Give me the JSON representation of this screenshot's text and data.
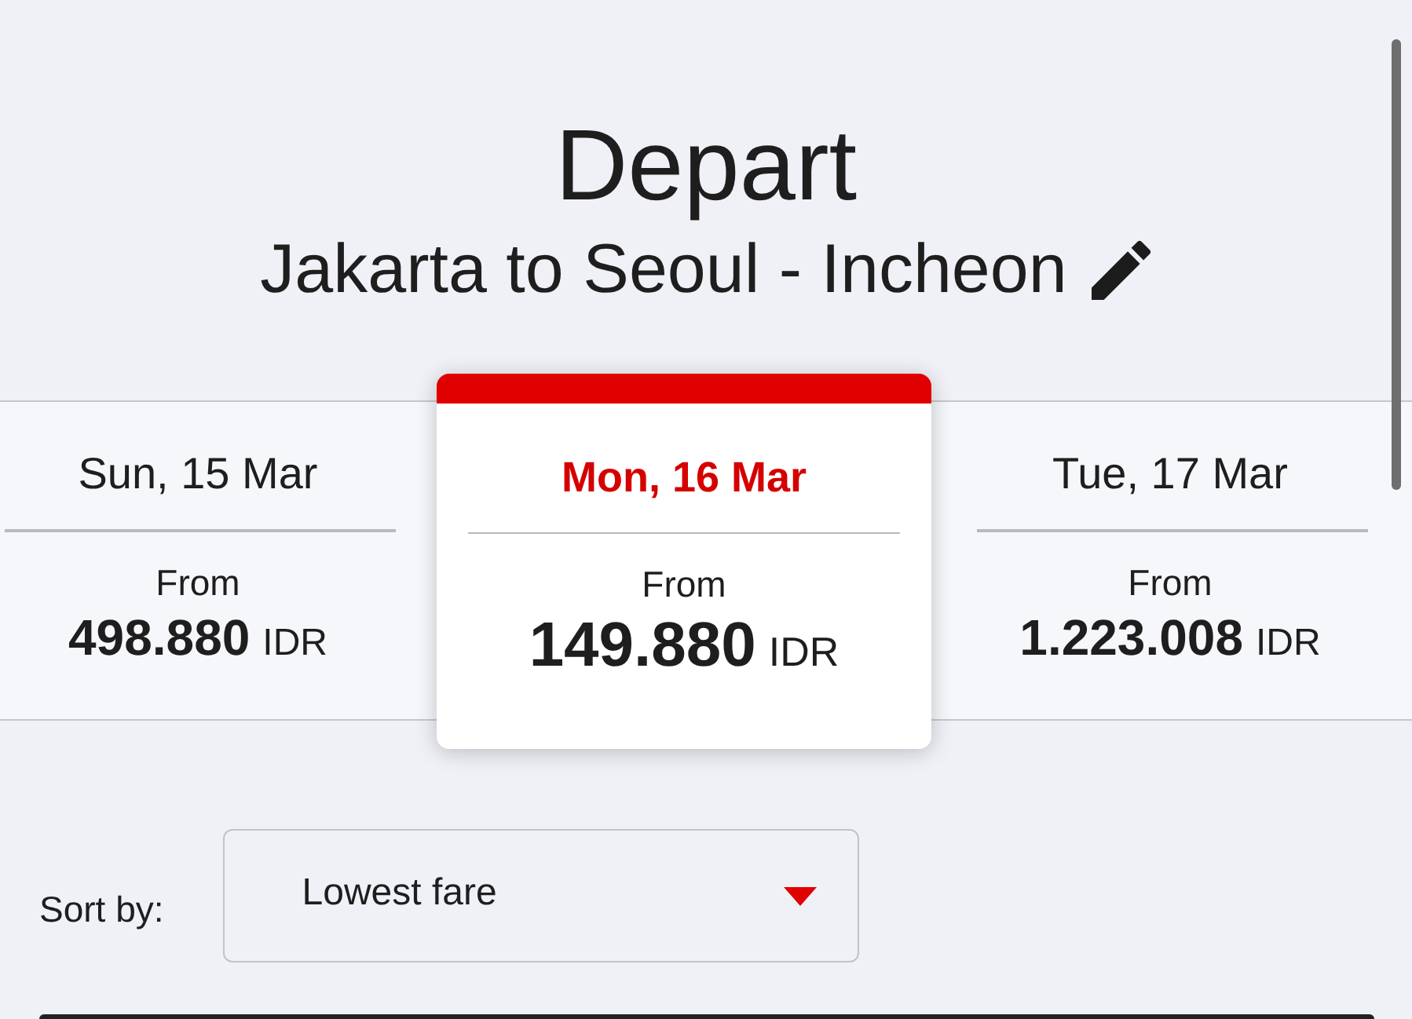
{
  "header": {
    "title": "Depart",
    "route": "Jakarta to Seoul - Incheon"
  },
  "dates": [
    {
      "date": "Sun, 15 Mar",
      "from_label": "From",
      "price": "498.880",
      "currency": "IDR",
      "selected": false
    },
    {
      "date": "Mon, 16 Mar",
      "from_label": "From",
      "price": "149.880",
      "currency": "IDR",
      "selected": true
    },
    {
      "date": "Tue, 17 Mar",
      "from_label": "From",
      "price": "1.223.008",
      "currency": "IDR",
      "selected": false
    }
  ],
  "sort": {
    "label": "Sort by:",
    "value": "Lowest fare"
  }
}
